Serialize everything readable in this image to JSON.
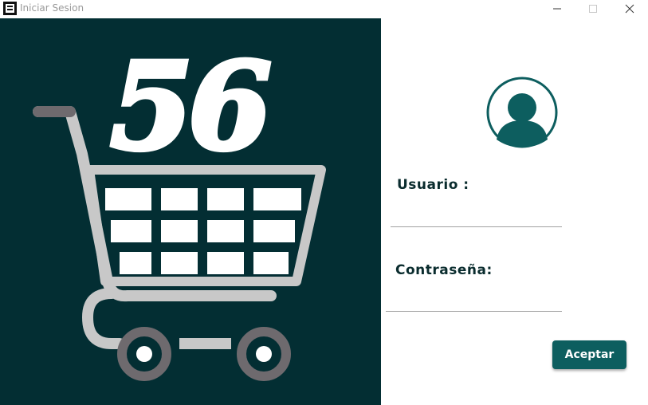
{
  "window": {
    "title": "Iniciar Sesion",
    "controls": [
      "minimize",
      "maximize",
      "close"
    ]
  },
  "logo": {
    "text": "56",
    "icon": "shopping-cart-icon"
  },
  "login_form": {
    "avatar_icon": "user-avatar-icon",
    "user_label": "Usuario :",
    "user_value": "",
    "password_label": "Contraseña:",
    "password_value": "",
    "accept_label": "Aceptar"
  },
  "colors": {
    "logo_background": "#032e33",
    "accent": "#0d5e5f",
    "cart_gray": "#c8c8c8",
    "wheel_gray": "#6e6a6e",
    "label_text": "#0a2c2e"
  }
}
